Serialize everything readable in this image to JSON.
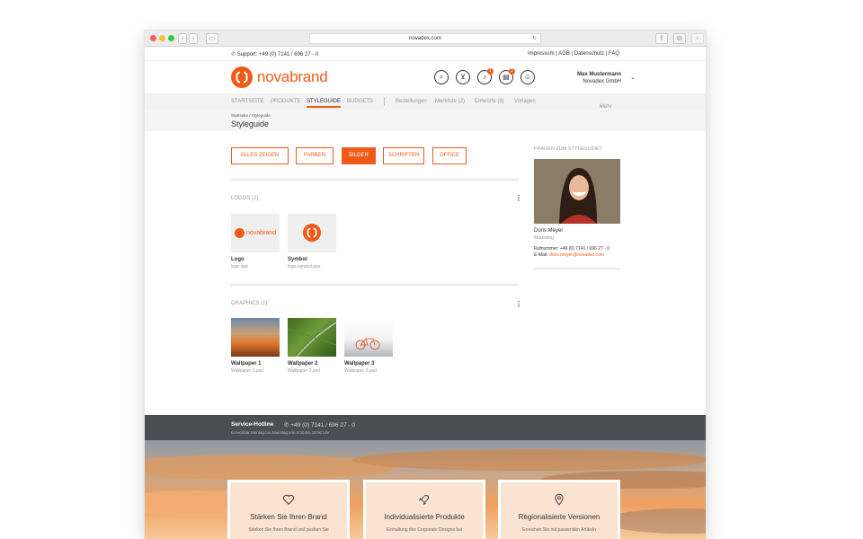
{
  "browser": {
    "url": "novadex.com",
    "dots": [
      "#fc605b",
      "#fdbc40",
      "#34c84a"
    ]
  },
  "topbar": {
    "support": "Support: +49 (0) 7141 / 696 27 - 0",
    "links": "Impressum | AGB | Datenschutz | FAQ"
  },
  "brand": {
    "name": "novabrand",
    "color": "#f05a19"
  },
  "header": {
    "icons": [
      "search-icon",
      "cart-icon",
      "bell-icon",
      "inbox-icon",
      "user-circle-icon"
    ],
    "badge_bell": "1",
    "badge_inbox": "2",
    "user_name": "Max Mustermann",
    "user_company": "Novadex GmbH"
  },
  "nav": {
    "items": [
      "STARTSEITE",
      "PRODUKTE",
      "STYLEGUIDE",
      "BUDGETS"
    ],
    "active": "STYLEGUIDE",
    "secondary": [
      "Bestellungen",
      "Merkliste (2)",
      "Entwürfe (8)",
      "Vorlagen"
    ],
    "more": "Mehr"
  },
  "page": {
    "breadcrumb": "Startseite / Styleguide",
    "title": "Styleguide"
  },
  "filters": {
    "all": "ALLES ZEIGEN",
    "colors": "FARBEN",
    "images": "BILDER",
    "fonts": "SCHRIFTEN",
    "office": "OFFICE"
  },
  "logos": {
    "heading": "LOGOS (2)",
    "items": [
      {
        "name": "Logo",
        "file": "logo.eps"
      },
      {
        "name": "Symbol",
        "file": "logo-symbol.eps"
      }
    ]
  },
  "graphics": {
    "heading": "GRAPHICS (1)",
    "items": [
      {
        "name": "Wallpaper 1",
        "file": "Wallpaper 1.psd"
      },
      {
        "name": "Wallpaper 2",
        "file": "Wallpaper 2.psd"
      },
      {
        "name": "Wallpaper 3",
        "file": "Wallpaper 3.psd"
      }
    ]
  },
  "sidebar": {
    "heading": "FRAGEN ZUM STYLEGUIDE?",
    "name": "Doris Meyer",
    "role": "Marketing",
    "phone": "Rufnummer: +49 (0) 7141 / 696 27 - 0",
    "email_label": "E-Mail:",
    "email": "doris.meyer@novadex.com"
  },
  "footer": {
    "title": "Service-Hotline",
    "phone": "+49 (0) 7141 / 696 27 - 0",
    "hours": "Erreichbar Montag bis Samstag von 8:00 bis 19:00 Uhr"
  },
  "cards": [
    {
      "title": "Stärken Sie Ihren Brand",
      "text": "Stärken Sie Ihren Brand und pushen Sie",
      "icon": "heart-icon"
    },
    {
      "title": "Individualisierte Produkte",
      "text": "Einhaltung des Corporate Designs bei",
      "icon": "rocket-icon"
    },
    {
      "title": "Regionalisierte Versionen",
      "text": "Erreichen Sie mit passenden Artikeln",
      "icon": "location-pin-icon"
    }
  ]
}
